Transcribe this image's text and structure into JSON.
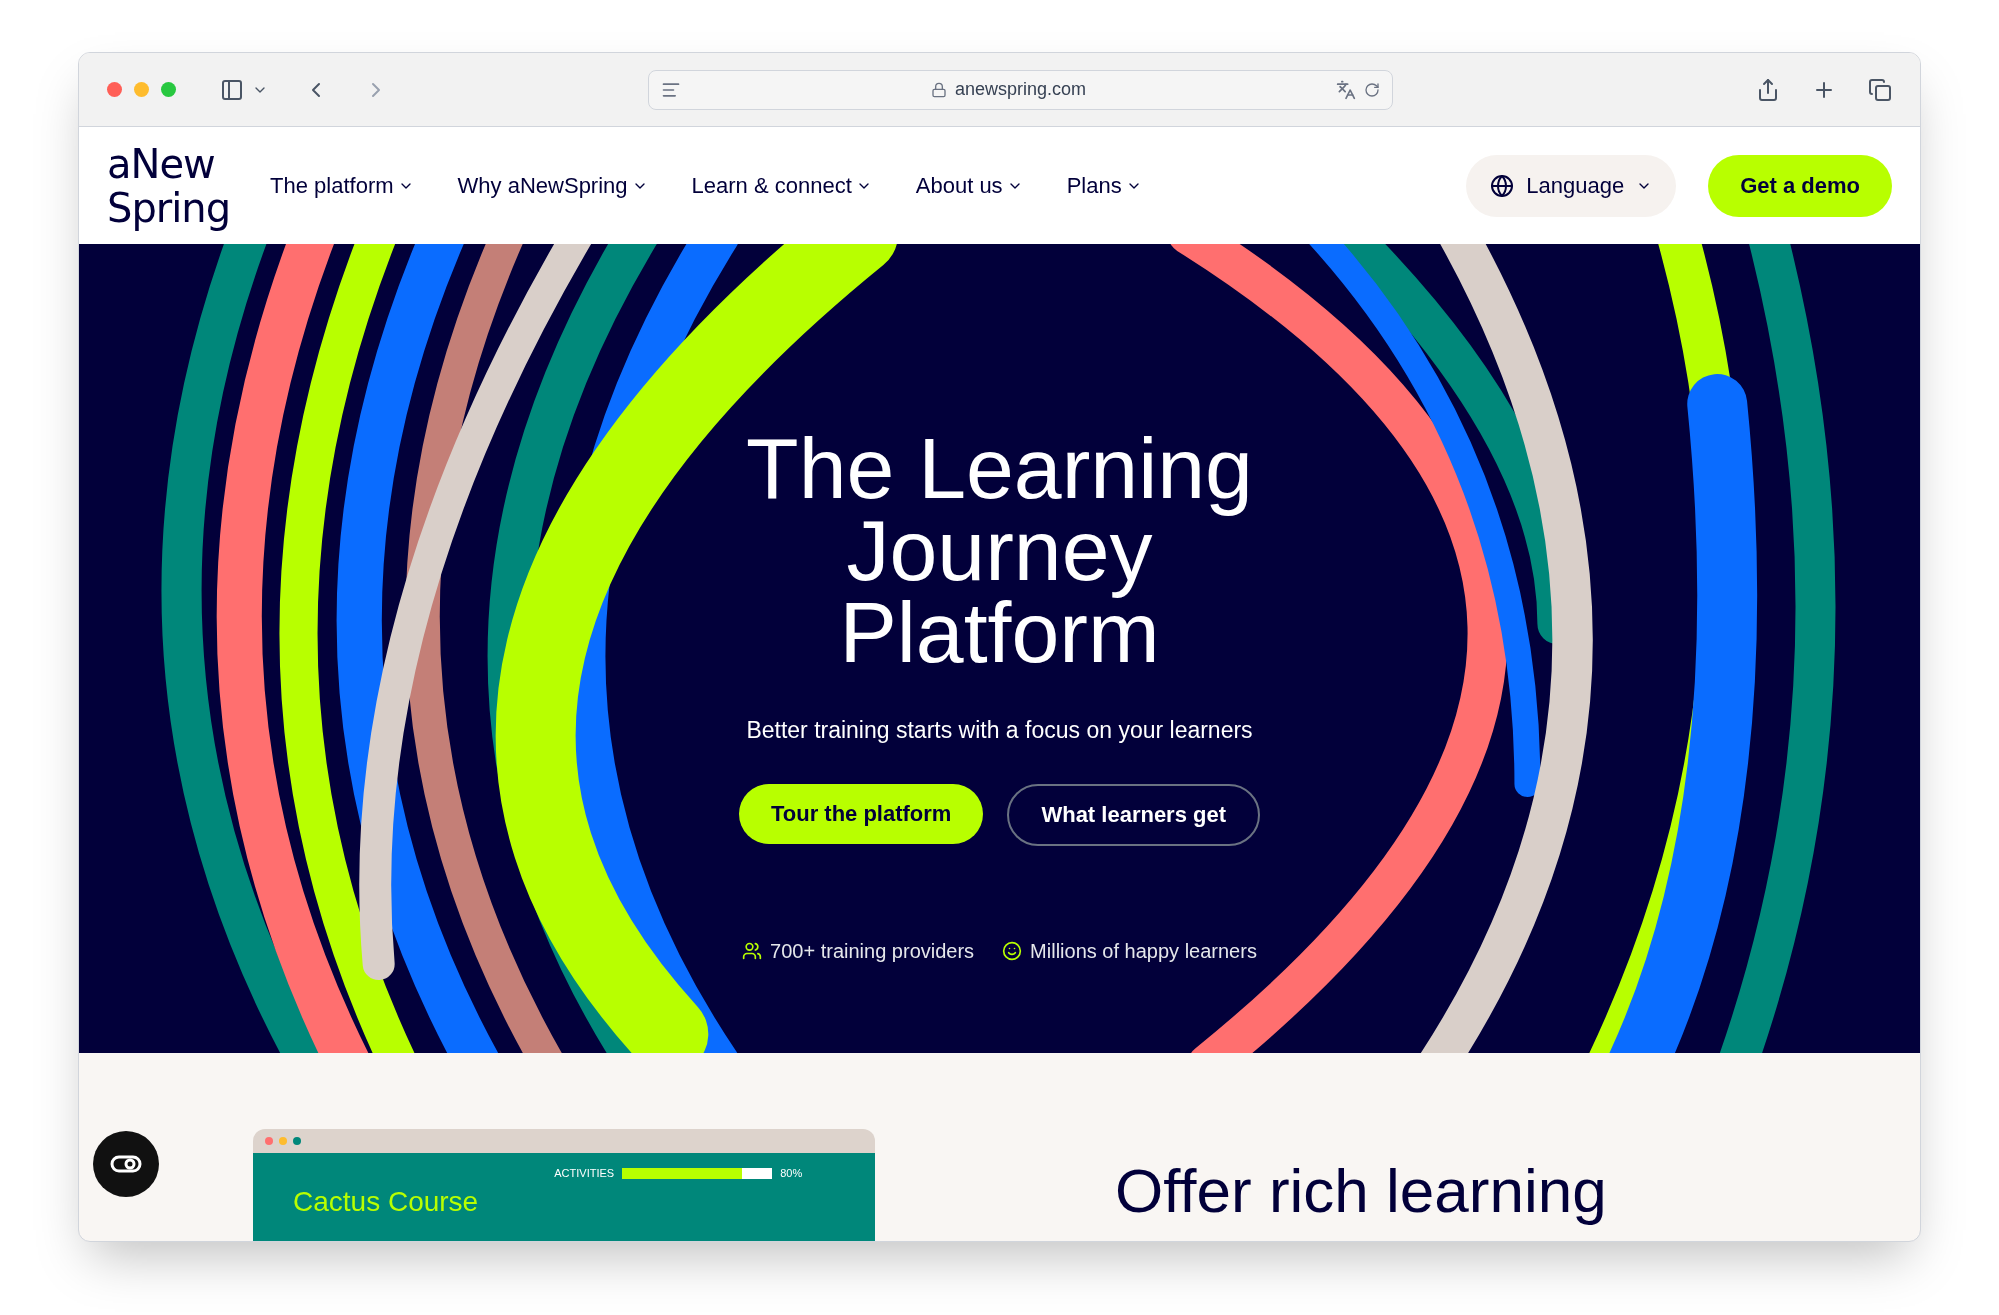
{
  "browser": {
    "url": "anewspring.com"
  },
  "logo": {
    "line1": "aNew",
    "line2": "Spring"
  },
  "nav": [
    {
      "label": "The platform"
    },
    {
      "label": "Why aNewSpring"
    },
    {
      "label": "Learn & connect"
    },
    {
      "label": "About us"
    },
    {
      "label": "Plans"
    }
  ],
  "language_button": "Language",
  "demo_button": "Get a demo",
  "hero": {
    "title": "The Learning Journey Platform",
    "subtitle": "Better training starts with a focus on your learners",
    "buttons": [
      {
        "label": "Tour the platform",
        "kind": "primary"
      },
      {
        "label": "What learners get",
        "kind": "outline"
      }
    ],
    "stats": [
      {
        "kind": "people",
        "label": "700+ training providers"
      },
      {
        "kind": "smile",
        "label": "Millions of happy learners"
      }
    ]
  },
  "preview": {
    "course": "Cactus Course",
    "bars": [
      {
        "label": "ACTIVITIES",
        "value": "80%",
        "level": 0.8
      }
    ]
  },
  "section_heading": "Offer rich learning"
}
